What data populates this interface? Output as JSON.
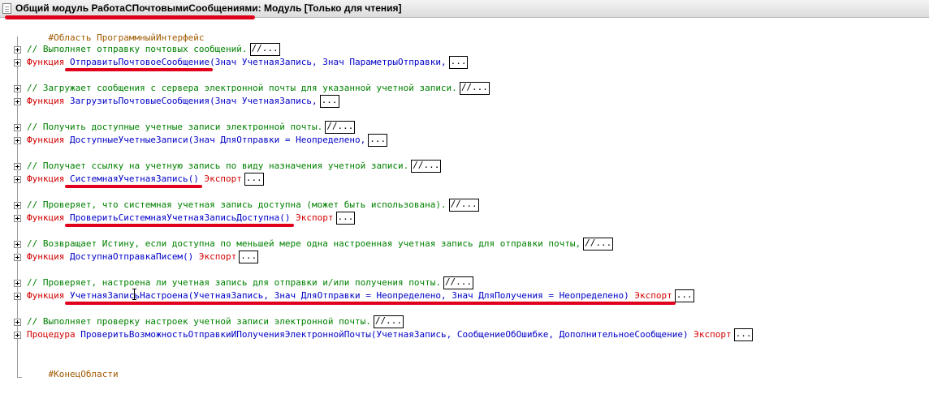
{
  "window": {
    "title": "Общий модуль РаботаСПочтовымиСообщениями: Модуль [Только для чтения]"
  },
  "code": {
    "region_start": "#Область ПрограммныйИнтерфейс",
    "region_end": "#КонецОбласти",
    "collapsed_comment": "//...",
    "collapsed_body": "...",
    "blocks": [
      {
        "comment": "// Выполняет отправку почтовых сообщений.",
        "keyword": "Функция",
        "name": "ОтправитьПочтовоеСообщение",
        "rest": "(Знач УчетнаяЗапись, Знач ПараметрыОтправки,",
        "export": ""
      },
      {
        "comment": "// Загружает сообщения с сервера электронной почты для указанной учетной записи.",
        "keyword": "Функция",
        "name": "ЗагрузитьПочтовыеСообщения",
        "rest": "(Знач УчетнаяЗапись,",
        "export": ""
      },
      {
        "comment": "// Получить доступные учетные записи электронной почты.",
        "keyword": "Функция",
        "name": "ДоступныеУчетныеЗаписи",
        "rest": "(Знач ДляОтправки = Неопределено,",
        "export": ""
      },
      {
        "comment": "// Получает ссылку на учетную запись по виду назначения учетной записи.",
        "keyword": "Функция",
        "name": "СистемнаяУчетнаяЗапись",
        "rest": "()",
        "export": " Экспорт"
      },
      {
        "comment": "// Проверяет, что системная учетная запись доступна (может быть использована).",
        "keyword": "Функция",
        "name": "ПроверитьСистемнаяУчетнаяЗаписьДоступна",
        "rest": "()",
        "export": " Экспорт"
      },
      {
        "comment": "// Возвращает Истину, если доступна по меньшей мере одна настроенная учетная запись для отправки почты,",
        "keyword": "Функция",
        "name": "ДоступнаОтправкаПисем",
        "rest": "()",
        "export": " Экспорт"
      },
      {
        "comment": "// Проверяет, настроена ли учетная запись для отправки и/или получения почты.",
        "keyword": "Функция",
        "name": "УчетнаяЗаписьНастроена",
        "rest": "(УчетнаяЗапись, Знач ДляОтправки = Неопределено, Знач ДляПолучения = Неопределено)",
        "export": " Экспорт"
      },
      {
        "comment": "// Выполняет проверку настроек учетной записи электронной почты.",
        "keyword": "Процедура",
        "name": "ПроверитьВозможностьОтправкиИПолученияЭлектроннойПочты",
        "rest": "(УчетнаяЗапись, СообщениеОбОшибке, ДополнительноеСообщение)",
        "export": " Экспорт"
      }
    ]
  },
  "colors": {
    "keyword": "#d40000",
    "identifier": "#0000c8",
    "comment": "#008000",
    "preprocessor": "#a05a00",
    "annotation": "#e0001b"
  }
}
